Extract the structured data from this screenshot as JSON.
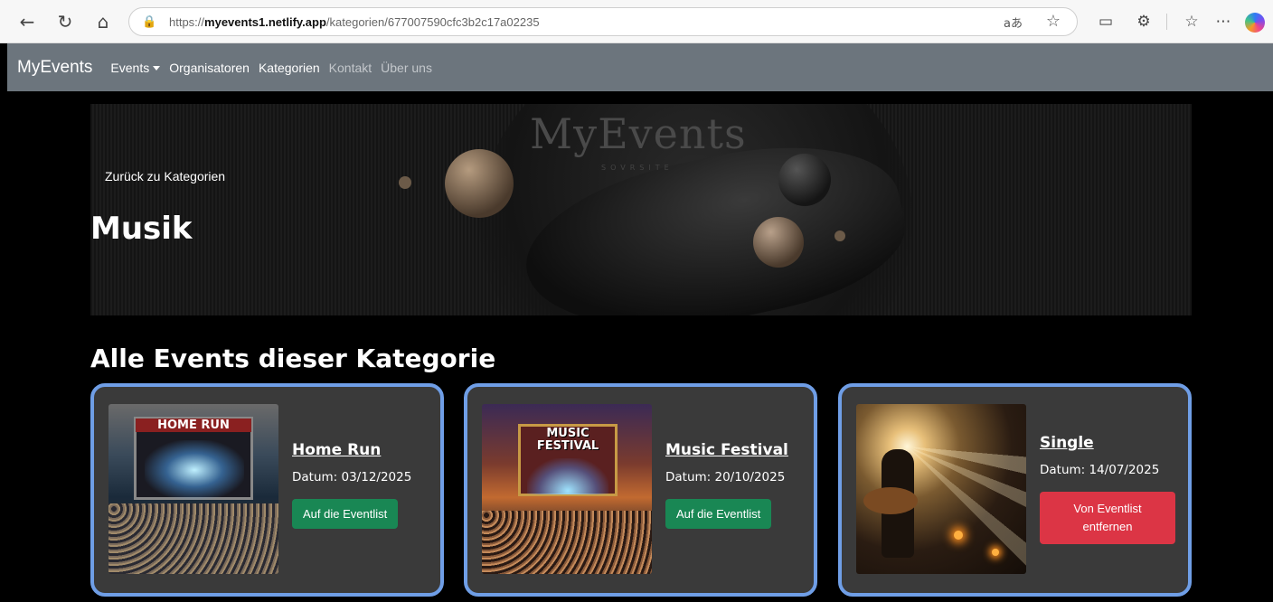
{
  "browser": {
    "url_domain": "myevents1.netlify.app",
    "url_path": "/kategorien/677007590cfc3b2c17a02235",
    "url_scheme": "https://",
    "read_aloud": "aあ"
  },
  "navbar": {
    "brand": "MyEvents",
    "links": [
      {
        "label": "Events",
        "dropdown": true
      },
      {
        "label": "Organisatoren"
      },
      {
        "label": "Kategorien"
      },
      {
        "label": "Kontakt",
        "muted": true
      },
      {
        "label": "Über uns",
        "muted": true
      }
    ]
  },
  "hero": {
    "back_link": "Zurück zu Kategorien",
    "title": "Musik",
    "logo_text": "MyEvents",
    "logo_sub": "SOVRSITE"
  },
  "section": {
    "title": "Alle Events dieser Kategorie"
  },
  "events": [
    {
      "name": "Home Run",
      "date": "Datum: 03/12/2025",
      "button": "Auf die Eventlist",
      "button_type": "add",
      "thumb_label": "HOME RUN"
    },
    {
      "name": "Music Festival",
      "date": "Datum: 20/10/2025",
      "button": "Auf die Eventlist",
      "button_type": "add",
      "thumb_label": "MUSIC FESTIVAL"
    },
    {
      "name": "Single",
      "date": "Datum: 14/07/2025",
      "button": "Von Eventlist entfernen",
      "button_type": "remove"
    }
  ],
  "colors": {
    "navbar": "#6c757d",
    "card_border": "#6f9ee6",
    "card_bg": "#3a3a3a",
    "btn_add": "#198754",
    "btn_remove": "#dc3545"
  }
}
